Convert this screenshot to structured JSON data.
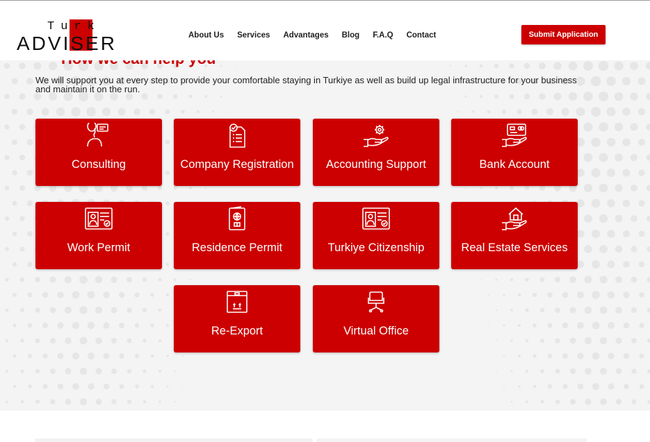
{
  "header": {
    "logo": {
      "top": "Turk",
      "main": "ADVISER"
    },
    "nav": [
      "About Us",
      "Services",
      "Advantages",
      "Blog",
      "F.A.Q",
      "Contact"
    ],
    "cta": "Submit Application"
  },
  "section": {
    "title": "How we can help you",
    "intro": "We will support you at every step to provide your comfortable staying in Turkiye as well as build up legal infrastructure for your business and maintain it on the run."
  },
  "services": [
    {
      "label": "Consulting",
      "icon": "consulting-icon"
    },
    {
      "label": "Company Registration",
      "icon": "document-check-icon"
    },
    {
      "label": "Accounting Support",
      "icon": "gear-hand-icon"
    },
    {
      "label": "Bank Account",
      "icon": "card-hand-icon"
    },
    {
      "label": "Work Permit",
      "icon": "id-card-icon"
    },
    {
      "label": "Residence Permit",
      "icon": "passport-icon"
    },
    {
      "label": "Turkiye Citizenship",
      "icon": "id-card-icon"
    },
    {
      "label": "Real Estate Services",
      "icon": "house-hand-icon"
    },
    {
      "label": "Re-Export",
      "icon": "box-icon"
    },
    {
      "label": "Virtual Office",
      "icon": "office-chair-icon"
    }
  ],
  "colors": {
    "brand": "#cc0000",
    "background": "#f4f4f4",
    "text": "#222222"
  }
}
